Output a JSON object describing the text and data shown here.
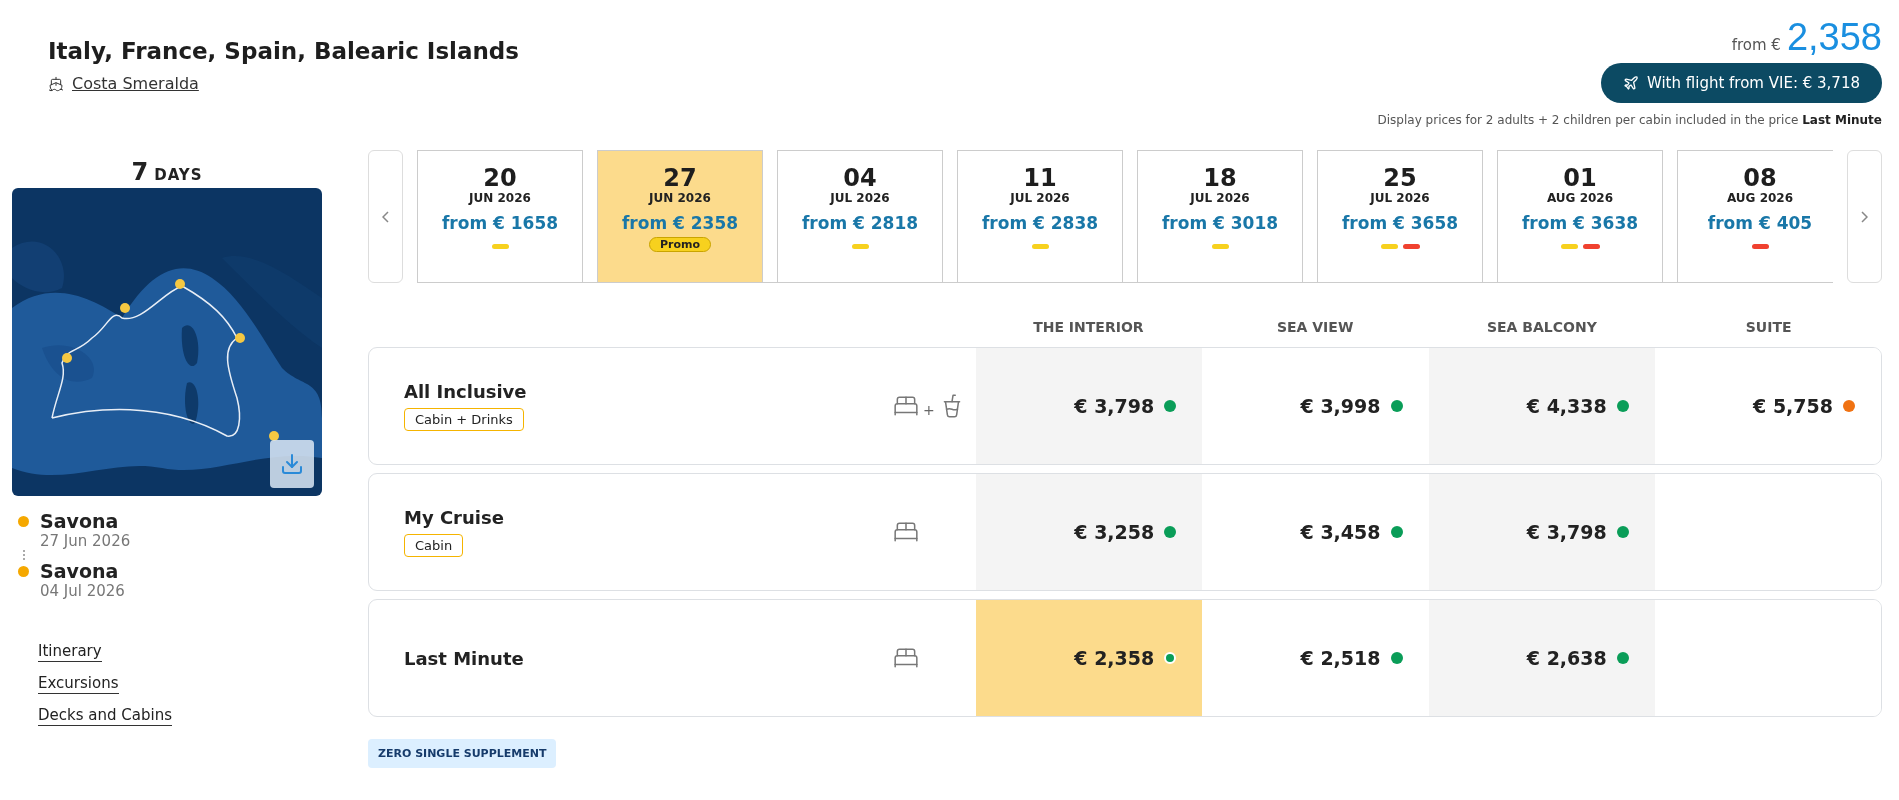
{
  "trip": {
    "title": "Italy, France, Spain, Balearic Islands",
    "ship": "Costa Smeralda"
  },
  "price_summary": {
    "from_label": "from €",
    "amount": "2,358",
    "flight_button": "With flight from VIE: € 3,718",
    "note": "Display prices for 2 adults + 2 children per cabin included in the price **Last Minute**"
  },
  "duration": {
    "number": "7",
    "unit": "DAYS"
  },
  "itinerary": [
    {
      "port": "Savona",
      "date": "27 Jun 2026"
    },
    {
      "port": "Savona",
      "date": "04 Jul 2026"
    }
  ],
  "links": [
    "Itinerary",
    "Excursions",
    "Decks and Cabins"
  ],
  "dates": [
    {
      "day": "20",
      "month": "JUN 2026",
      "price": "from € 1658",
      "selected": false,
      "marks": [
        {
          "color": "#f7d11e"
        }
      ]
    },
    {
      "day": "27",
      "month": "JUN 2026",
      "price": "from € 2358",
      "selected": true,
      "badge": "Promo"
    },
    {
      "day": "04",
      "month": "JUL 2026",
      "price": "from € 2818",
      "selected": false,
      "marks": [
        {
          "color": "#f7d11e"
        }
      ]
    },
    {
      "day": "11",
      "month": "JUL 2026",
      "price": "from € 2838",
      "selected": false,
      "marks": [
        {
          "color": "#f7d11e"
        }
      ]
    },
    {
      "day": "18",
      "month": "JUL 2026",
      "price": "from € 3018",
      "selected": false,
      "marks": [
        {
          "color": "#f7d11e"
        }
      ]
    },
    {
      "day": "25",
      "month": "JUL 2026",
      "price": "from € 3658",
      "selected": false,
      "marks": [
        {
          "color": "#f7d11e"
        },
        {
          "color": "#f0412f"
        }
      ]
    },
    {
      "day": "01",
      "month": "AUG 2026",
      "price": "from € 3638",
      "selected": false,
      "marks": [
        {
          "color": "#f7d11e"
        },
        {
          "color": "#f0412f"
        }
      ]
    },
    {
      "day": "08",
      "month": "AUG 2026",
      "price": "from € 405",
      "selected": false,
      "marks": [
        {
          "color": "#f0412f"
        }
      ]
    }
  ],
  "cabin_columns": [
    "THE INTERIOR",
    "SEA VIEW",
    "SEA BALCONY",
    "SUITE"
  ],
  "fares": [
    {
      "name": "All Inclusive",
      "tag": "Cabin + Drinks",
      "kind": "cabin_drinks",
      "joiner": "+",
      "cells": [
        {
          "price": "€ 3,798",
          "color": "#0a9d58",
          "selected": false
        },
        {
          "price": "€ 3,998",
          "color": "#0a9d58",
          "selected": false
        },
        {
          "price": "€ 4,338",
          "color": "#0a9d58",
          "selected": false
        },
        {
          "price": "€ 5,758",
          "color": "#f07212",
          "selected": false
        }
      ]
    },
    {
      "name": "My Cruise",
      "tag": "Cabin",
      "kind": "cabin",
      "cells": [
        {
          "price": "€ 3,258",
          "color": "#0a9d58",
          "selected": false
        },
        {
          "price": "€ 3,458",
          "color": "#0a9d58",
          "selected": false
        },
        {
          "price": "€ 3,798",
          "color": "#0a9d58",
          "selected": false
        }
      ]
    },
    {
      "name": "Last Minute",
      "kind": "cabin",
      "cells": [
        {
          "price": "€ 2,358",
          "color": "#0a9d58",
          "selected": true
        },
        {
          "price": "€ 2,518",
          "color": "#0a9d58",
          "selected": false
        },
        {
          "price": "€ 2,638",
          "color": "#0a9d58",
          "selected": false
        }
      ]
    }
  ],
  "footer_badge": "ZERO SINGLE SUPPLEMENT"
}
